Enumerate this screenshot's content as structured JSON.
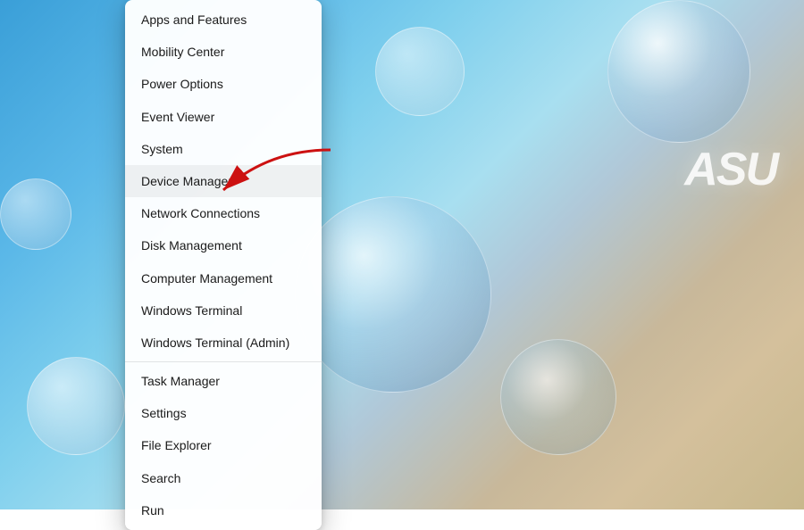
{
  "background": {
    "asus_logo": "ASU"
  },
  "context_menu": {
    "items": [
      {
        "id": "apps-features",
        "label": "Apps and Features",
        "separator_after": false
      },
      {
        "id": "mobility-center",
        "label": "Mobility Center",
        "separator_after": false
      },
      {
        "id": "power-options",
        "label": "Power Options",
        "separator_after": false
      },
      {
        "id": "event-viewer",
        "label": "Event Viewer",
        "separator_after": false
      },
      {
        "id": "system",
        "label": "System",
        "separator_after": false
      },
      {
        "id": "device-manager",
        "label": "Device Manager",
        "separator_after": false,
        "highlighted": true
      },
      {
        "id": "network-connections",
        "label": "Network Connections",
        "separator_after": false
      },
      {
        "id": "disk-management",
        "label": "Disk Management",
        "separator_after": false
      },
      {
        "id": "computer-management",
        "label": "Computer Management",
        "separator_after": false
      },
      {
        "id": "windows-terminal",
        "label": "Windows Terminal",
        "separator_after": false
      },
      {
        "id": "windows-terminal-admin",
        "label": "Windows Terminal (Admin)",
        "separator_after": true
      },
      {
        "id": "task-manager",
        "label": "Task Manager",
        "separator_after": false
      },
      {
        "id": "settings",
        "label": "Settings",
        "separator_after": false
      },
      {
        "id": "file-explorer",
        "label": "File Explorer",
        "separator_after": false
      },
      {
        "id": "search",
        "label": "Search",
        "separator_after": false
      },
      {
        "id": "run",
        "label": "Run",
        "separator_after": false
      }
    ]
  }
}
